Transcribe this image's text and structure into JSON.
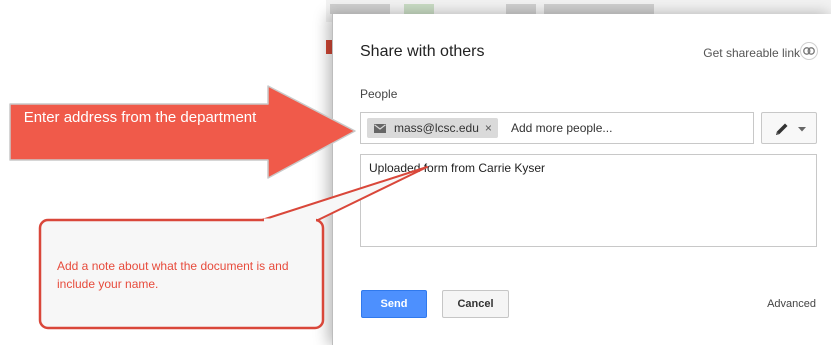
{
  "dialog": {
    "title": "Share with others",
    "shareable_link_label": "Get shareable link",
    "people_label": "People",
    "recipient_chip": "mass@lcsc.edu",
    "chip_remove": "×",
    "add_people_placeholder": "Add more people...",
    "note_text": "Uploaded form from Carrie Kyser",
    "send_label": "Send",
    "cancel_label": "Cancel",
    "advanced_label": "Advanced"
  },
  "annotations": {
    "arrow_text": "Enter address from the department",
    "callout_text": "Add a note about what the document is and include your name."
  },
  "colors": {
    "annotation_red": "#f05a4a",
    "send_blue": "#4d90fe"
  },
  "icons": {
    "chip": "mail-icon",
    "link": "link-icon",
    "permission": "pencil-icon",
    "dropdown": "caret-down-icon"
  }
}
